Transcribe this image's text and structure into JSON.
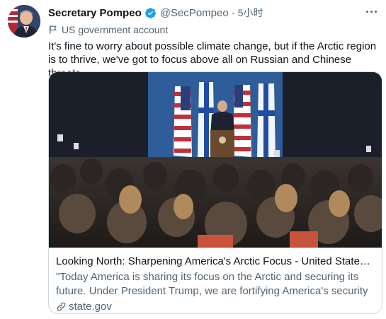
{
  "author": {
    "display_name": "Secretary Pompeo",
    "handle": "@SecPompeo",
    "separator": "·",
    "time": "5小时",
    "label": "US government account"
  },
  "tweet": {
    "text": "It's fine to worry about possible climate change, but if the Arctic region is to thrive, we've got to focus above all on Russian and Chinese threats."
  },
  "card": {
    "title": "Looking North: Sharpening America's Arctic Focus - United States Dep...",
    "description": "\"Today America is sharing its focus on the Arctic and securing its future. Under President Trump, we are fortifying America's security and",
    "domain": "state.gov"
  },
  "icons": {
    "verified": "verified-badge-icon",
    "label": "government-flag-icon",
    "more": "more-options-icon",
    "link": "link-icon"
  },
  "colors": {
    "verified_blue": "#1d9bf0",
    "secondary_text": "#536471",
    "primary_text": "#0f1419",
    "border": "#cfd9de"
  }
}
